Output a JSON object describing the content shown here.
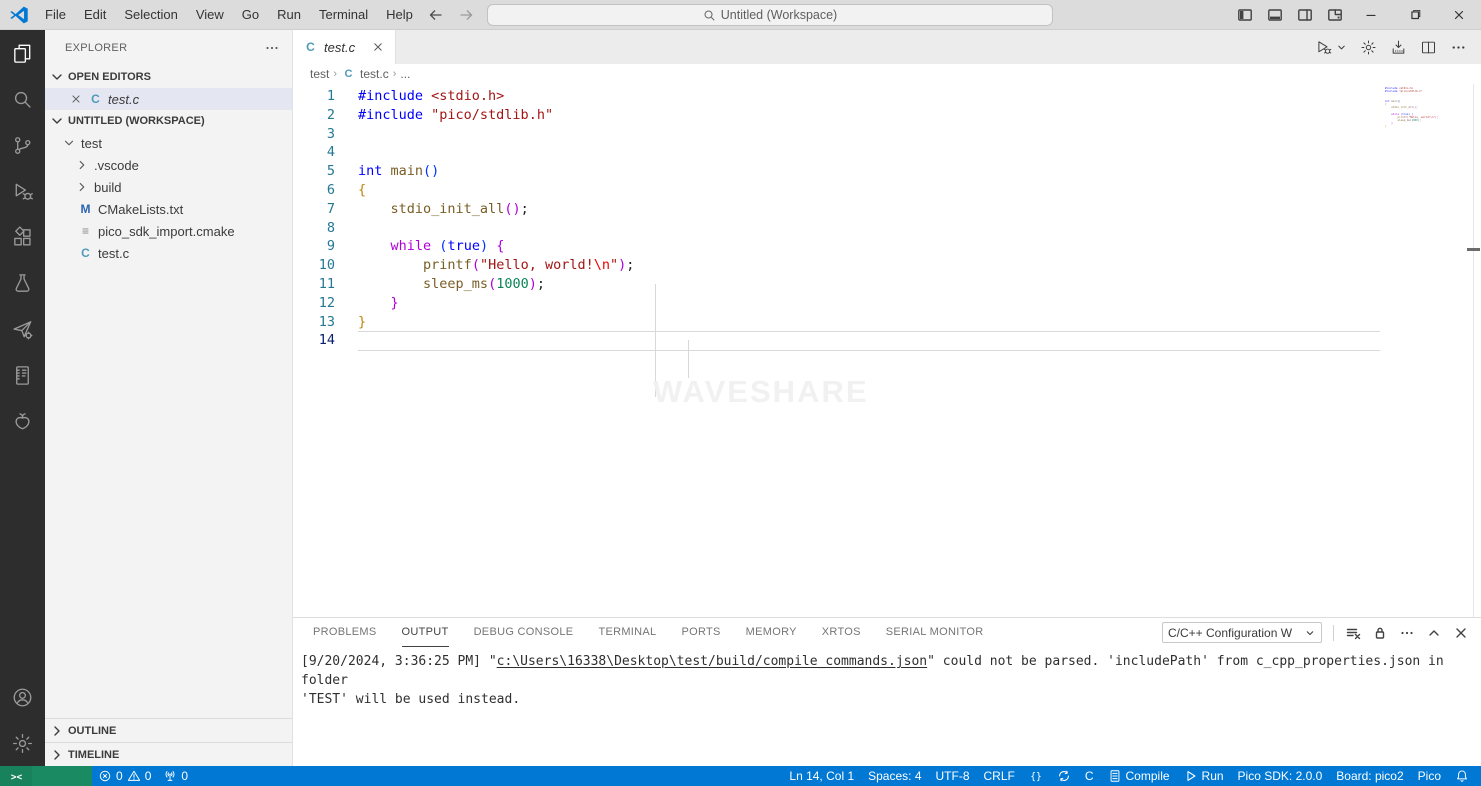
{
  "titlebar": {
    "menus": [
      "File",
      "Edit",
      "Selection",
      "View",
      "Go",
      "Run",
      "Terminal",
      "Help"
    ],
    "search_label": "Untitled (Workspace)",
    "layout_icons": [
      "panel-left",
      "panel-bottom",
      "panel-right",
      "layout-custom"
    ],
    "window_controls": [
      "minimize",
      "maximize",
      "close"
    ]
  },
  "activity_bar": {
    "top": [
      {
        "name": "explorer",
        "icon": "files",
        "active": true
      },
      {
        "name": "search",
        "icon": "search",
        "active": false
      },
      {
        "name": "source-control",
        "icon": "source-control",
        "active": false
      },
      {
        "name": "run-and-debug",
        "icon": "run-debug",
        "active": false
      },
      {
        "name": "extensions",
        "icon": "extensions",
        "active": false
      },
      {
        "name": "testing",
        "icon": "flask",
        "active": false
      },
      {
        "name": "pico-sdk",
        "icon": "plane-gear",
        "active": false
      },
      {
        "name": "datasheets",
        "icon": "datasheet",
        "active": false
      },
      {
        "name": "raspberry-pi",
        "icon": "raspberry",
        "active": false
      }
    ],
    "bottom": [
      {
        "name": "accounts",
        "icon": "account"
      },
      {
        "name": "manage",
        "icon": "gear"
      }
    ]
  },
  "sidebar": {
    "title": "EXPLORER",
    "open_editors": {
      "label": "OPEN EDITORS",
      "items": [
        {
          "label": "test.c",
          "badge": "C",
          "badge_type": "c",
          "italic": true,
          "selected": true
        }
      ]
    },
    "workspace": {
      "label": "UNTITLED (WORKSPACE)",
      "tree": [
        {
          "label": "test",
          "depth": 1,
          "chevron": "down"
        },
        {
          "label": ".vscode",
          "depth": 2,
          "chevron": "right"
        },
        {
          "label": "build",
          "depth": 2,
          "chevron": "right"
        },
        {
          "label": "CMakeLists.txt",
          "depth": 2,
          "badge": "M",
          "badge_type": "m"
        },
        {
          "label": "pico_sdk_import.cmake",
          "depth": 2,
          "badge": "≡",
          "badge_type": "generic"
        },
        {
          "label": "test.c",
          "depth": 2,
          "badge": "C",
          "badge_type": "c"
        }
      ]
    },
    "bottom_sections": [
      "OUTLINE",
      "TIMELINE"
    ]
  },
  "editor": {
    "tab": {
      "label": "test.c",
      "badge": "C"
    },
    "actions": [
      {
        "name": "run-c-file",
        "icon": "run-file",
        "dropdown": true
      },
      {
        "name": "debug-settings",
        "icon": "gear"
      },
      {
        "name": "flash-project",
        "icon": "deploy"
      },
      {
        "name": "split-editor",
        "icon": "split"
      },
      {
        "name": "more-actions",
        "icon": "more"
      }
    ],
    "breadcrumbs": [
      {
        "label": "test"
      },
      {
        "label": "test.c",
        "badge": "C"
      },
      {
        "label": "..."
      }
    ],
    "watermark": "WAVESHARE",
    "code_lines": [
      {
        "n": "1",
        "tokens": [
          [
            "pp",
            "#include "
          ],
          [
            "str",
            "<stdio.h>"
          ]
        ]
      },
      {
        "n": "2",
        "tokens": [
          [
            "pp",
            "#include "
          ],
          [
            "str",
            "\"pico/stdlib.h\""
          ]
        ]
      },
      {
        "n": "3",
        "tokens": []
      },
      {
        "n": "4",
        "tokens": []
      },
      {
        "n": "5",
        "tokens": [
          [
            "kw",
            "int"
          ],
          [
            "pl",
            " "
          ],
          [
            "fn",
            "main"
          ],
          [
            "pb",
            "()"
          ]
        ]
      },
      {
        "n": "6",
        "tokens": [
          [
            "pg",
            "{"
          ]
        ]
      },
      {
        "n": "7",
        "tokens": [
          [
            "pl",
            "    "
          ],
          [
            "fn",
            "stdio_init_all"
          ],
          [
            "pv",
            "()"
          ],
          [
            "pl",
            ";"
          ]
        ]
      },
      {
        "n": "8",
        "tokens": []
      },
      {
        "n": "9",
        "tokens": [
          [
            "pl",
            "    "
          ],
          [
            "ctl",
            "while"
          ],
          [
            "pl",
            " "
          ],
          [
            "pb",
            "("
          ],
          [
            "kw",
            "true"
          ],
          [
            "pb",
            ")"
          ],
          [
            "pl",
            " "
          ],
          [
            "pv",
            "{"
          ]
        ]
      },
      {
        "n": "10",
        "tokens": [
          [
            "pl",
            "        "
          ],
          [
            "fn",
            "printf"
          ],
          [
            "pv",
            "("
          ],
          [
            "str",
            "\"Hello, world!"
          ],
          [
            "esc",
            "\\n"
          ],
          [
            "str",
            "\""
          ],
          [
            "pv",
            ")"
          ],
          [
            "pl",
            ";"
          ]
        ]
      },
      {
        "n": "11",
        "tokens": [
          [
            "pl",
            "        "
          ],
          [
            "fn",
            "sleep_ms"
          ],
          [
            "pv",
            "("
          ],
          [
            "num",
            "1000"
          ],
          [
            "pv",
            ")"
          ],
          [
            "pl",
            ";"
          ]
        ]
      },
      {
        "n": "12",
        "tokens": [
          [
            "pl",
            "    "
          ],
          [
            "pv",
            "}"
          ]
        ]
      },
      {
        "n": "13",
        "tokens": [
          [
            "pg",
            "}"
          ]
        ]
      },
      {
        "n": "14",
        "tokens": [],
        "current": true
      }
    ]
  },
  "panel": {
    "tabs": [
      {
        "label": "PROBLEMS"
      },
      {
        "label": "OUTPUT",
        "active": true
      },
      {
        "label": "DEBUG CONSOLE"
      },
      {
        "label": "TERMINAL"
      },
      {
        "label": "PORTS"
      },
      {
        "label": "MEMORY"
      },
      {
        "label": "XRTOS"
      },
      {
        "label": "SERIAL MONITOR"
      }
    ],
    "dropdown_label": "C/C++ Configuration W",
    "icons": [
      "clear-output",
      "lock",
      "more",
      "chevron-up",
      "close"
    ],
    "output_lines": [
      [
        {
          "text": "[9/20/2024, 3:36:25 PM] \""
        },
        {
          "text": "c:\\Users\\16338\\Desktop\\test/build/compile_commands.json",
          "link": true
        },
        {
          "text": "\" could not be parsed. 'includePath' from c_cpp_properties.json in folder"
        }
      ],
      [
        {
          "text": "'TEST' will be used instead."
        }
      ]
    ]
  },
  "status_bar": {
    "left": [
      {
        "name": "remote-indicator",
        "remote": true,
        "parts": [
          {
            "icon": "remote"
          }
        ]
      },
      {
        "name": "problems-summary",
        "parts": [
          {
            "icon": "error-circle"
          },
          {
            "text": "0"
          },
          {
            "icon": "warning-triangle"
          },
          {
            "text": "0"
          }
        ]
      },
      {
        "name": "forwarded-ports",
        "parts": [
          {
            "icon": "radio-tower"
          },
          {
            "text": "0"
          }
        ]
      }
    ],
    "right": [
      {
        "name": "cursor-position",
        "parts": [
          {
            "text": "Ln 14, Col 1"
          }
        ]
      },
      {
        "name": "indentation",
        "parts": [
          {
            "text": "Spaces: 4"
          }
        ]
      },
      {
        "name": "encoding",
        "parts": [
          {
            "text": "UTF-8"
          }
        ]
      },
      {
        "name": "end-of-line",
        "parts": [
          {
            "text": "CRLF"
          }
        ]
      },
      {
        "name": "language-status",
        "parts": [
          {
            "icon": "braces"
          }
        ]
      },
      {
        "name": "sync-indicator",
        "parts": [
          {
            "icon": "sync"
          }
        ]
      },
      {
        "name": "language-mode",
        "parts": [
          {
            "text": "C"
          }
        ]
      },
      {
        "name": "compile-project",
        "parts": [
          {
            "icon": "file-binary"
          },
          {
            "text": "Compile"
          }
        ]
      },
      {
        "name": "run-project",
        "parts": [
          {
            "icon": "play-outline"
          },
          {
            "text": "Run"
          }
        ]
      },
      {
        "name": "pico-sdk-version",
        "parts": [
          {
            "text": "Pico SDK: 2.0.0"
          }
        ]
      },
      {
        "name": "board-selector",
        "parts": [
          {
            "text": "Board: pico2"
          }
        ]
      },
      {
        "name": "pico-extension",
        "parts": [
          {
            "text": "Pico"
          }
        ]
      },
      {
        "name": "notifications",
        "parts": [
          {
            "icon": "bell"
          }
        ]
      }
    ],
    "colors": {
      "background": "#0078d4",
      "remote_background": "#17825c"
    }
  }
}
